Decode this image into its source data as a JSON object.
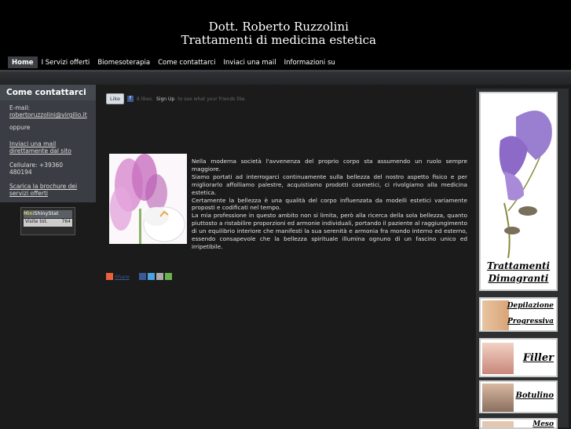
{
  "header": {
    "title_line1": "Dott. Roberto Ruzzolini",
    "title_line2": "Trattamenti di medicina estetica"
  },
  "nav": {
    "items": [
      {
        "label": "Home",
        "active": true
      },
      {
        "label": "I Servizi offerti"
      },
      {
        "label": "Biomesoterapia"
      },
      {
        "label": "Come contattarci"
      },
      {
        "label": "Inviaci una mail"
      },
      {
        "label": "Informazioni su"
      }
    ]
  },
  "sidebar": {
    "heading": "Come contattarci",
    "email_label": "E-mail:",
    "email_value": "robertoruzzolini@virgilio.it",
    "oppure": "oppure",
    "mail_link": "Inviaci una mail direttamente dal sito",
    "phone": "Cellulare: +39360 480194",
    "brochure_link": "Scarica la brochure dei servizi offerti",
    "counter": {
      "brand_a": "Mini",
      "brand_b": "ShinyStat",
      "label": "Visite tot.",
      "value": "764"
    }
  },
  "facebook": {
    "like_label": "Like",
    "count_text": "8 likes.",
    "signup": "Sign Up",
    "tail": "to see what your friends like."
  },
  "content": {
    "paragraphs": [
      "Nella moderna società l'avvenenza del proprio corpo sta assumendo un ruolo sempre maggiore.",
      "Siamo portati ad interrogarci continuamente sulla bellezza del nostro aspetto fisico e per migliorarlo affolliamo palestre, acquistiamo prodotti cosmetici, ci rivolgiamo alla medicina estetica.",
      "Certamente la bellezza è una qualità del corpo influenzata da modelli estetici variamente proposti e codificati nel tempo.",
      "La mia professione in questo ambito non si limita, però alla ricerca della sola bellezza, quanto piuttosto a ristabilire proporzioni ed armonie individuali, portando il paziente al raggiungimento di un equilibrio interiore che manifesti la sua serenità e armonia fra mondo interno ed esterno, essendo consapevole che la bellezza spirituale illumina ognuno di un fascino unico ed irripetibile."
    ]
  },
  "share": {
    "label": "Share"
  },
  "ads": {
    "ad1": "Trattamenti Dimagranti",
    "ad2_line1": "Depilazione",
    "ad2_line2": "Progressiva",
    "ad3": "Filler",
    "ad4": "Botulino",
    "ad5": "Meso"
  },
  "colors": {
    "background": "#1b1b1b",
    "header": "#000000",
    "sidebar": "#3a3d43",
    "accent_fb": "#3b5998"
  }
}
